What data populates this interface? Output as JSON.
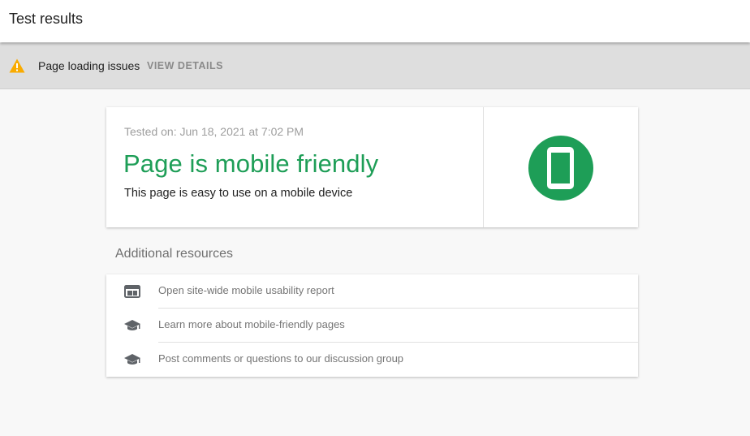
{
  "header": {
    "title": "Test results"
  },
  "issue_bar": {
    "icon": "warning-icon",
    "text": "Page loading issues",
    "action_label": "VIEW DETAILS",
    "warning_color": "#f9ab00"
  },
  "result": {
    "tested_on": "Tested on: Jun 18, 2021 at 7:02 PM",
    "verdict": "Page is mobile friendly",
    "description": "This page is easy to use on a mobile device",
    "badge_icon": "smartphone-icon",
    "success_color": "#1e9e57"
  },
  "resources": {
    "heading": "Additional resources",
    "items": [
      {
        "icon": "web-report-icon",
        "label": "Open site-wide mobile usability report"
      },
      {
        "icon": "school-cap-icon",
        "label": "Learn more about mobile-friendly pages"
      },
      {
        "icon": "school-cap-icon",
        "label": "Post comments or questions to our discussion group"
      }
    ]
  }
}
